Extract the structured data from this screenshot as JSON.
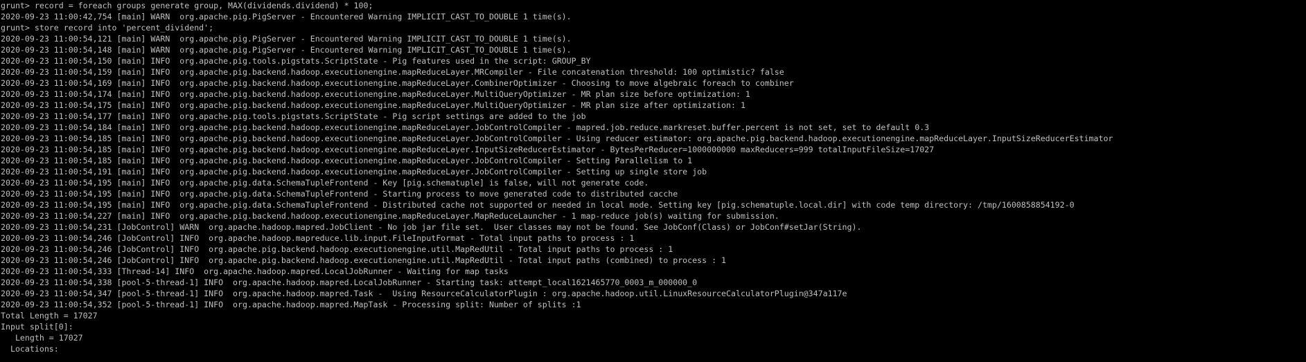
{
  "terminal": {
    "foreground": "#c0c0c0",
    "background": "#000000",
    "lines": [
      "grunt> record = foreach groups generate group, MAX(dividends.dividend) * 100;",
      "2020-09-23 11:00:42,754 [main] WARN  org.apache.pig.PigServer - Encountered Warning IMPLICIT_CAST_TO_DOUBLE 1 time(s).",
      "grunt> store record into 'percent_dividend';",
      "2020-09-23 11:00:54,121 [main] WARN  org.apache.pig.PigServer - Encountered Warning IMPLICIT_CAST_TO_DOUBLE 1 time(s).",
      "2020-09-23 11:00:54,148 [main] WARN  org.apache.pig.PigServer - Encountered Warning IMPLICIT_CAST_TO_DOUBLE 1 time(s).",
      "2020-09-23 11:00:54,150 [main] INFO  org.apache.pig.tools.pigstats.ScriptState - Pig features used in the script: GROUP_BY",
      "2020-09-23 11:00:54,159 [main] INFO  org.apache.pig.backend.hadoop.executionengine.mapReduceLayer.MRCompiler - File concatenation threshold: 100 optimistic? false",
      "2020-09-23 11:00:54,169 [main] INFO  org.apache.pig.backend.hadoop.executionengine.mapReduceLayer.CombinerOptimizer - Choosing to move algebraic foreach to combiner",
      "2020-09-23 11:00:54,174 [main] INFO  org.apache.pig.backend.hadoop.executionengine.mapReduceLayer.MultiQueryOptimizer - MR plan size before optimization: 1",
      "2020-09-23 11:00:54,175 [main] INFO  org.apache.pig.backend.hadoop.executionengine.mapReduceLayer.MultiQueryOptimizer - MR plan size after optimization: 1",
      "2020-09-23 11:00:54,177 [main] INFO  org.apache.pig.tools.pigstats.ScriptState - Pig script settings are added to the job",
      "2020-09-23 11:00:54,184 [main] INFO  org.apache.pig.backend.hadoop.executionengine.mapReduceLayer.JobControlCompiler - mapred.job.reduce.markreset.buffer.percent is not set, set to default 0.3",
      "2020-09-23 11:00:54,185 [main] INFO  org.apache.pig.backend.hadoop.executionengine.mapReduceLayer.JobControlCompiler - Using reducer estimator: org.apache.pig.backend.hadoop.executionengine.mapReduceLayer.InputSizeReducerEstimator",
      "2020-09-23 11:00:54,185 [main] INFO  org.apache.pig.backend.hadoop.executionengine.mapReduceLayer.InputSizeReducerEstimator - BytesPerReducer=1000000000 maxReducers=999 totalInputFileSize=17027",
      "2020-09-23 11:00:54,185 [main] INFO  org.apache.pig.backend.hadoop.executionengine.mapReduceLayer.JobControlCompiler - Setting Parallelism to 1",
      "2020-09-23 11:00:54,191 [main] INFO  org.apache.pig.backend.hadoop.executionengine.mapReduceLayer.JobControlCompiler - Setting up single store job",
      "2020-09-23 11:00:54,195 [main] INFO  org.apache.pig.data.SchemaTupleFrontend - Key [pig.schematuple] is false, will not generate code.",
      "2020-09-23 11:00:54,195 [main] INFO  org.apache.pig.data.SchemaTupleFrontend - Starting process to move generated code to distributed cacche",
      "2020-09-23 11:00:54,195 [main] INFO  org.apache.pig.data.SchemaTupleFrontend - Distributed cache not supported or needed in local mode. Setting key [pig.schematuple.local.dir] with code temp directory: /tmp/1600858854192-0",
      "2020-09-23 11:00:54,227 [main] INFO  org.apache.pig.backend.hadoop.executionengine.mapReduceLayer.MapReduceLauncher - 1 map-reduce job(s) waiting for submission.",
      "2020-09-23 11:00:54,231 [JobControl] WARN  org.apache.hadoop.mapred.JobClient - No job jar file set.  User classes may not be found. See JobConf(Class) or JobConf#setJar(String).",
      "2020-09-23 11:00:54,246 [JobControl] INFO  org.apache.hadoop.mapreduce.lib.input.FileInputFormat - Total input paths to process : 1",
      "2020-09-23 11:00:54,246 [JobControl] INFO  org.apache.pig.backend.hadoop.executionengine.util.MapRedUtil - Total input paths to process : 1",
      "2020-09-23 11:00:54,246 [JobControl] INFO  org.apache.pig.backend.hadoop.executionengine.util.MapRedUtil - Total input paths (combined) to process : 1",
      "2020-09-23 11:00:54,333 [Thread-14] INFO  org.apache.hadoop.mapred.LocalJobRunner - Waiting for map tasks",
      "2020-09-23 11:00:54,338 [pool-5-thread-1] INFO  org.apache.hadoop.mapred.LocalJobRunner - Starting task: attempt_local1621465770_0003_m_000000_0",
      "2020-09-23 11:00:54,347 [pool-5-thread-1] INFO  org.apache.hadoop.mapred.Task -  Using ResourceCalculatorPlugin : org.apache.hadoop.util.LinuxResourceCalculatorPlugin@347a117e",
      "2020-09-23 11:00:54,352 [pool-5-thread-1] INFO  org.apache.hadoop.mapred.MapTask - Processing split: Number of splits :1",
      "Total Length = 17027",
      "Input split[0]:",
      "   Length = 17027",
      "  Locations:"
    ]
  }
}
